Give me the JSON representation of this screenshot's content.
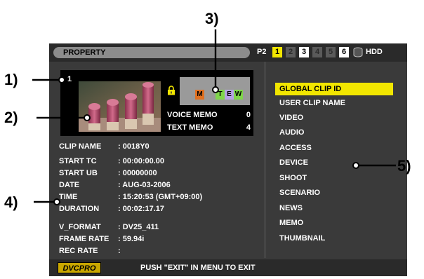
{
  "header": {
    "title": "PROPERTY",
    "p2_label": "P2",
    "slots": [
      "1",
      "2",
      "3",
      "4",
      "5",
      "6"
    ],
    "hdd_label": "HDD"
  },
  "clip": {
    "number": "1",
    "marks": [
      "M",
      "T",
      "E",
      "W"
    ],
    "voice_memo_label": "VOICE MEMO",
    "voice_memo_count": "0",
    "text_memo_label": "TEXT MEMO",
    "text_memo_count": "4"
  },
  "info_rows": [
    {
      "label": "CLIP NAME",
      "value": ": 0018Y0"
    },
    {
      "label": "START TC",
      "value": ": 00:00:00.00"
    },
    {
      "label": "START UB",
      "value": ": 00000000"
    },
    {
      "label": "DATE",
      "value": ": AUG-03-2006"
    },
    {
      "label": "TIME",
      "value": ": 15:20:53 (GMT+09:00)"
    },
    {
      "label": "DURATION",
      "value": ": 00:02:17.17"
    },
    {
      "label": "V_FORMAT",
      "value": ": DV25_411"
    },
    {
      "label": "FRAME RATE",
      "value": ": 59.94i"
    },
    {
      "label": "REC RATE",
      "value": ":"
    }
  ],
  "menu": {
    "items": [
      "GLOBAL CLIP ID",
      "USER CLIP NAME",
      "VIDEO",
      "AUDIO",
      "ACCESS",
      "DEVICE",
      "SHOOT",
      "SCENARIO",
      "NEWS",
      "MEMO",
      "THUMBNAIL"
    ],
    "selected_index": 0
  },
  "footer": {
    "badge": "DVCPRO",
    "message": "PUSH \"EXIT\" IN MENU TO EXIT"
  },
  "callouts": [
    "1)",
    "2)",
    "3)",
    "4)",
    "5)"
  ],
  "colors": {
    "screen_bg": "#3a3a3a",
    "highlight": "#f2e600",
    "mark_m": "#e07020",
    "mark_t": "#7fd64a",
    "mark_e": "#b6a1e6",
    "mark_w": "#7fd64a"
  }
}
